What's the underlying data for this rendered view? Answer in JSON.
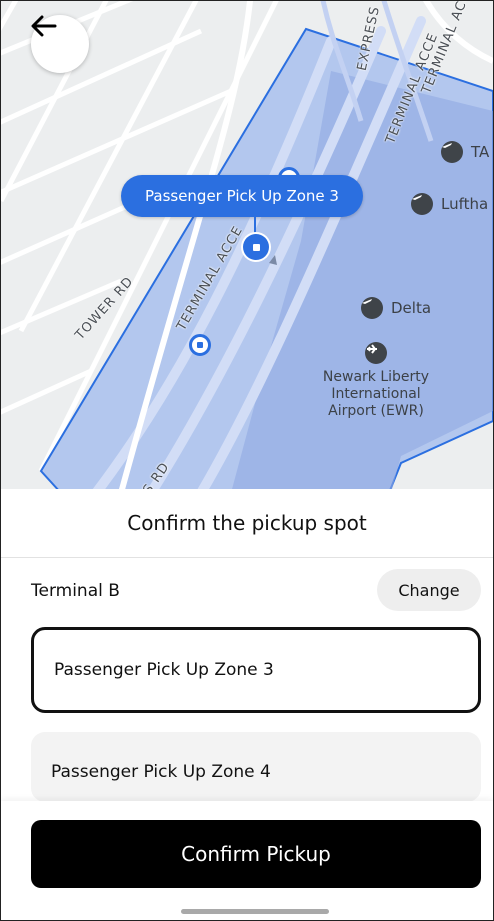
{
  "map": {
    "back_icon": "arrow-left-icon",
    "road_labels": {
      "tower_rd": "TOWER RD",
      "terminal_access_1": "TERMINAL ACCE",
      "terminal_access_2": "TERMINAL ACCE",
      "terminal_access_3": "TERMINAL ACCE",
      "express": "EXPRESS",
      "rd_bottom": "S RD"
    },
    "pois": {
      "ta": "TA",
      "lufthansa": "Luftha",
      "delta": "Delta",
      "airport": "Newark Liberty\nInternational\nAirport (EWR)"
    },
    "tooltip": "Passenger Pick Up Zone 3",
    "zone_color": "#2b6fe0"
  },
  "sheet": {
    "title": "Confirm the pickup spot",
    "terminal": "Terminal B",
    "change_label": "Change",
    "options": [
      {
        "label": "Passenger Pick Up Zone 3",
        "selected": true
      },
      {
        "label": "Passenger Pick Up Zone 4",
        "selected": false
      }
    ]
  },
  "footer": {
    "confirm_label": "Confirm Pickup"
  }
}
